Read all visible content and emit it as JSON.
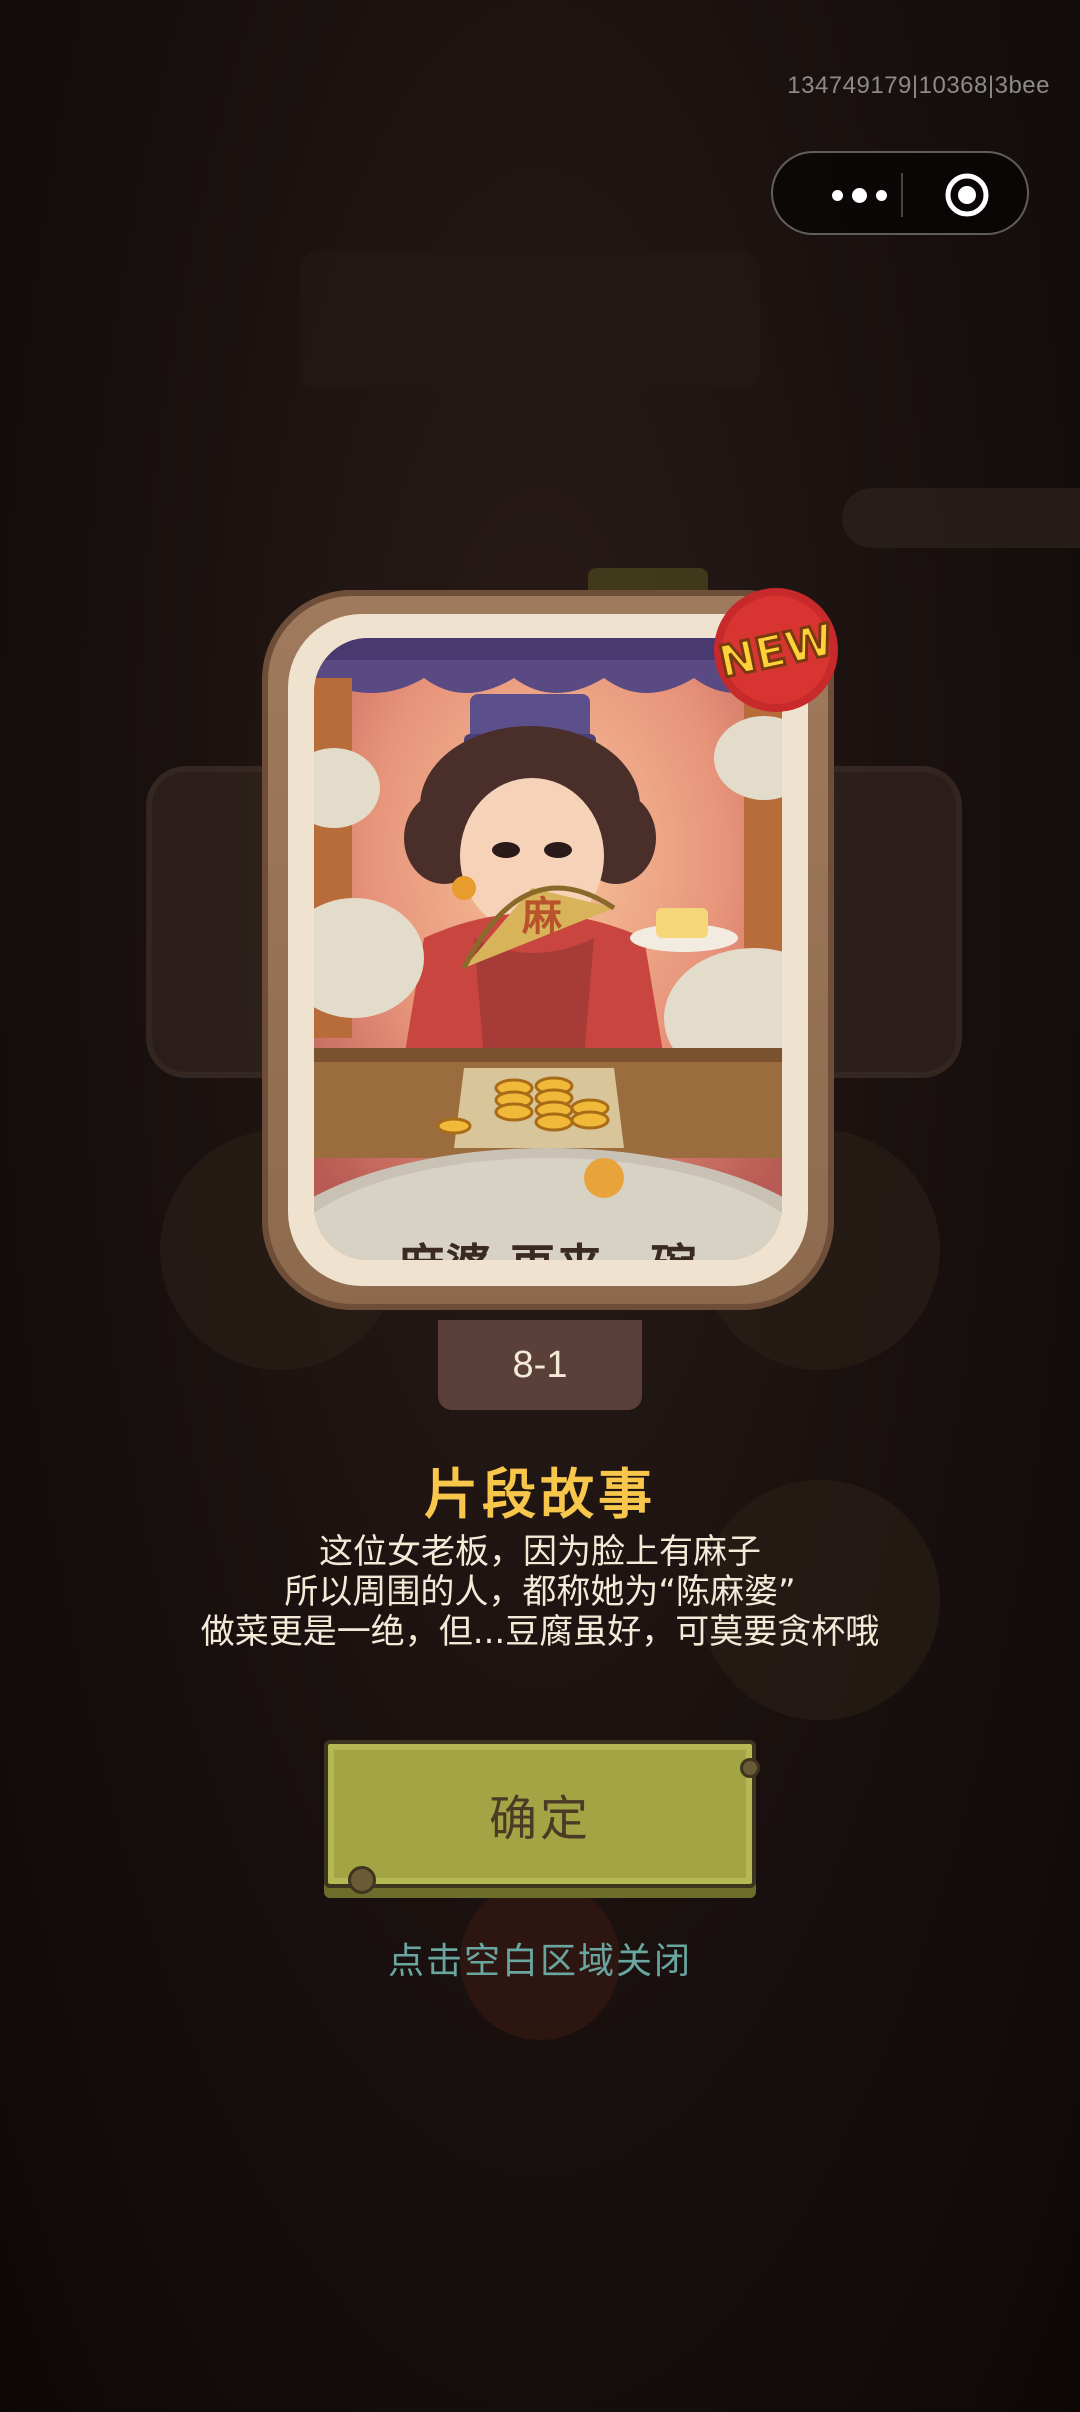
{
  "status_bar": {
    "id_text": "134749179|10368|3bee"
  },
  "capsule_menu": {
    "more_icon": "more-dots-icon",
    "close_icon": "target-close-icon"
  },
  "story_card": {
    "title": "麻婆 再来一碗",
    "fan_char": "麻",
    "badge": "NEW"
  },
  "level": {
    "label": "8-1"
  },
  "story": {
    "heading": "片段故事",
    "lines": [
      "这位女老板，因为脸上有麻子",
      "所以周围的人，都称她为“陈麻婆”",
      "做菜更是一绝，但...豆腐虽好，可莫要贪杯哦"
    ]
  },
  "actions": {
    "confirm_label": "确定",
    "close_hint": "点击空白区域关闭"
  },
  "colors": {
    "accent_gold": "#f7c64b",
    "button_green": "#a3a544",
    "hint_teal": "#6aa6a0"
  }
}
